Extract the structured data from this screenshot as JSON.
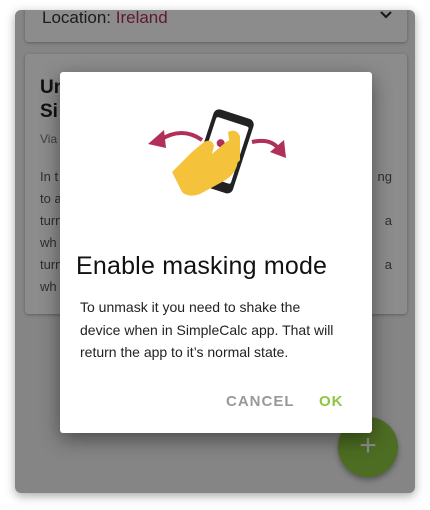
{
  "location": {
    "label": "Location:",
    "value": "Ireland"
  },
  "info_card": {
    "title": "Un\nSi",
    "subtitle": "Via",
    "lines": [
      {
        "left": "In t",
        "right": "ng"
      },
      {
        "left": "to a",
        "right": ""
      },
      {
        "left": "turn",
        "right": "a"
      },
      {
        "left": "wh",
        "right": ""
      },
      {
        "left": "turn",
        "right": "a"
      },
      {
        "left": "wh",
        "right": ""
      }
    ]
  },
  "fab": {
    "icon": "plus-icon",
    "glyph": "+"
  },
  "dialog": {
    "title": "Enable masking mode",
    "body_lines": [
      "To unmask it you need to shake the",
      "device when in SimpleCalc app. That will",
      "return the app to it’s normal state."
    ],
    "cancel_label": "CANCEL",
    "ok_label": "OK"
  },
  "colors": {
    "accent_green": "#8dc63f",
    "arrow_red": "#b03058",
    "hand_yellow": "#f5c33b"
  }
}
